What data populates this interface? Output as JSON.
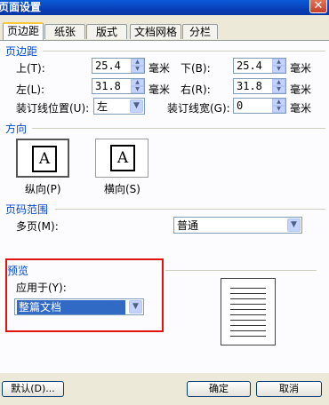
{
  "window": {
    "title": "页面设置",
    "close_glyph": "✕"
  },
  "tabs": [
    {
      "label": "页边距",
      "active": true
    },
    {
      "label": "纸张"
    },
    {
      "label": "版式"
    },
    {
      "label": "文档网格"
    },
    {
      "label": "分栏"
    }
  ],
  "margins": {
    "section_title": "页边距",
    "top_label": "上(T):",
    "top_value": "25.4",
    "top_unit": "毫米",
    "bottom_label": "下(B):",
    "bottom_value": "25.4",
    "bottom_unit": "毫米",
    "left_label": "左(L):",
    "left_value": "31.8",
    "left_unit": "毫米",
    "right_label": "右(R):",
    "right_value": "31.8",
    "right_unit": "毫米",
    "gutter_pos_label": "装订线位置(U):",
    "gutter_pos_value": "左",
    "gutter_label": "装订线宽(G):",
    "gutter_value": "0",
    "gutter_unit": "毫米"
  },
  "orientation": {
    "section_title": "方向",
    "portrait_label": "纵向(P)",
    "landscape_label": "横向(S)",
    "icon_letter": "A"
  },
  "pages": {
    "section_title": "页码范围",
    "multiple_label": "多页(M):",
    "multiple_value": "普通"
  },
  "preview": {
    "section_title": "预览",
    "apply_label": "应用于(Y):",
    "apply_value": "整篇文档"
  },
  "buttons": {
    "default": "默认(D)...",
    "ok": "确定",
    "cancel": "取消"
  },
  "colors": {
    "accent": "#0046d5",
    "highlight": "#e01212",
    "selection": "#316ac5"
  }
}
